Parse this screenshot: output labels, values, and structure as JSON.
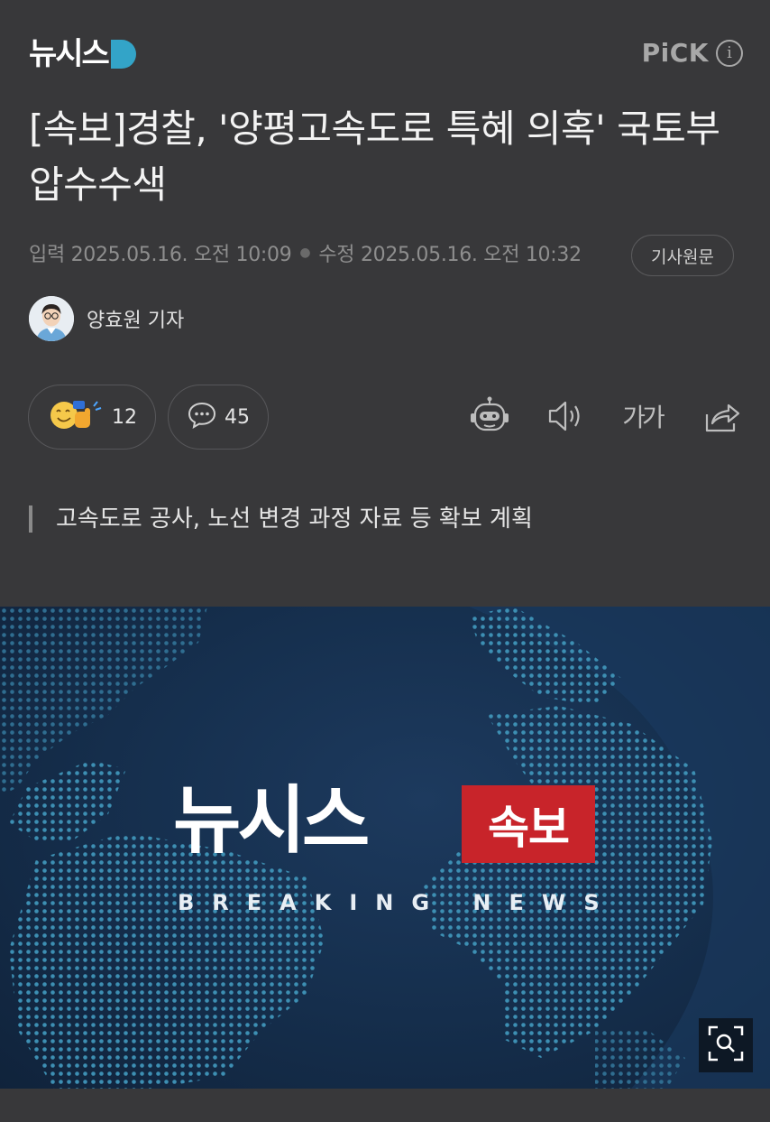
{
  "header": {
    "logo_text": "뉴시스",
    "pick_text": "PiCK",
    "info_icon": "info-icon"
  },
  "article": {
    "headline": "[속보]경찰, '양평고속도로 특혜 의혹' 국토부 압수수색",
    "published_label": "입력",
    "published": "2025.05.16. 오전 10:09",
    "modified_label": "수정",
    "modified": "2025.05.16. 오전 10:32",
    "original_button": "기사원문",
    "reporter": "양효원 기자",
    "subtitle": "고속도로 공사, 노선 변경 과정 자료 등 확보 계획"
  },
  "reactions": {
    "like_count": "12",
    "comment_count": "45"
  },
  "toolbar": {
    "font_size_label": "가가",
    "icons": [
      "robot-summary-icon",
      "speaker-icon",
      "font-size-icon",
      "share-icon"
    ]
  },
  "hero": {
    "brand": "뉴시스",
    "badge": "속보",
    "breaking": "BREAKING NEWS",
    "zoom_icon": "zoom-icon"
  },
  "colors": {
    "background": "#38383a",
    "brand_accent": "#33a4c8",
    "badge_red": "#c8242a",
    "hero_navy": "#16304f"
  }
}
